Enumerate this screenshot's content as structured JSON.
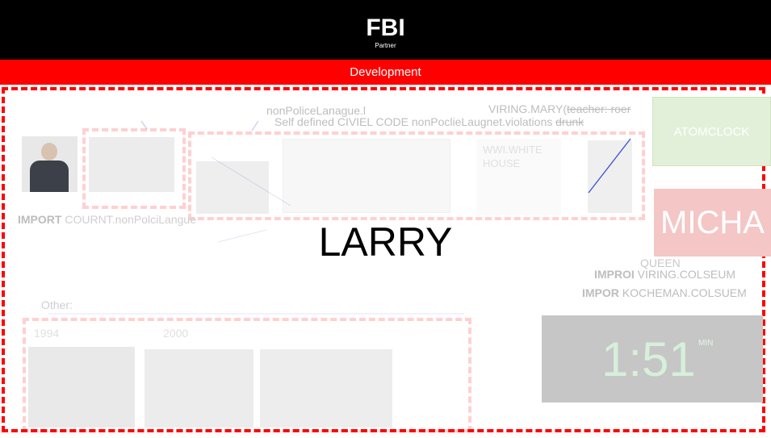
{
  "header": {
    "title": "FBI",
    "subtitle": "Partner"
  },
  "banner": {
    "label": "Development"
  },
  "top_text": {
    "line1": "nonPoliceLanague.l",
    "line2": "Self defined CIVIEL CODE nonPoclieLaugnet.violations",
    "line2_strike": "drunk",
    "viring": "VIRING.MARY(",
    "viring_strike": "teacher: roer"
  },
  "left_import": {
    "bold": "IMPORT",
    "rest": "COURNT.nonPolciLangue"
  },
  "thumbnail_caption": {
    "line1": "WWI.WHITE",
    "line2": "HOUSE"
  },
  "center_title": "LARRY",
  "right": {
    "atomclock": "ATOMCLOCK",
    "micha": "MICHA",
    "queen": "QUEEN",
    "import1_bold": "IMPROI",
    "import1_rest": "VIRING.COLSEUM",
    "import2_bold": "IMPOR",
    "import2_rest": "KOCHEMAN.COLSUEM"
  },
  "other": {
    "label": "Other:",
    "year1": "1994",
    "year2": "2000"
  },
  "clock": {
    "time": "1:51",
    "unit": "MIN"
  },
  "colors": {
    "header_bg": "#000000",
    "banner_bg": "#ff0000",
    "frame": "#ff0000",
    "atom_bg": "#e2f0d9",
    "micha_bg": "#f4c6c6",
    "clock_bg": "#c6c6c6"
  }
}
